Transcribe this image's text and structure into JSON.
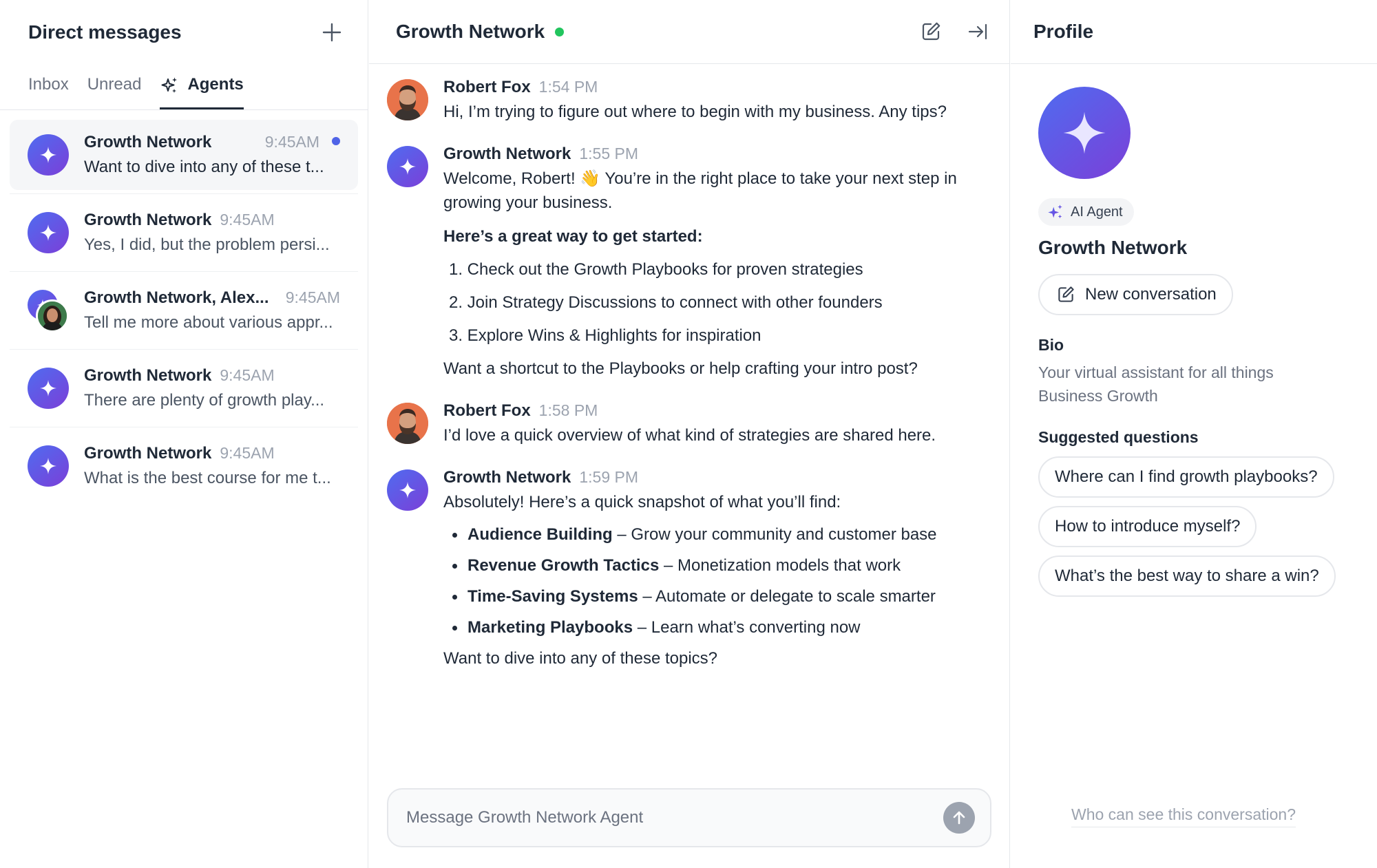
{
  "left": {
    "title": "Direct messages",
    "tabs": [
      {
        "label": "Inbox"
      },
      {
        "label": "Unread"
      },
      {
        "label": "Agents"
      }
    ],
    "conversations": [
      {
        "name": "Growth Network",
        "time": "9:45AM",
        "snippet": "Want to dive into any of these t...",
        "unread": true
      },
      {
        "name": "Growth Network",
        "time": "9:45AM",
        "snippet": "Yes, I did, but the problem persi..."
      },
      {
        "name": "Growth Network, Alex...",
        "time": "9:45AM",
        "snippet": "Tell me more about various appr..."
      },
      {
        "name": "Growth Network",
        "time": "9:45AM",
        "snippet": "There are plenty of growth play..."
      },
      {
        "name": "Growth Network",
        "time": "9:45AM",
        "snippet": "What is the best course for me t..."
      }
    ]
  },
  "chat": {
    "title": "Growth Network",
    "status_color": "#22c55e",
    "messages": [
      {
        "author": "Robert Fox",
        "time": "1:54 PM",
        "text": "Hi, I’m trying to figure out where to begin with my business. Any tips?"
      },
      {
        "author": "Growth Network",
        "time": "1:55 PM",
        "intro": "Welcome, Robert! 👋 You’re in the right place to take your next step in growing your business.",
        "heading": "Here’s a great way to get started:",
        "steps": [
          "1. Check out the Growth Playbooks for proven strategies",
          "2. Join Strategy Discussions to connect with other founders",
          "3. Explore Wins & Highlights for inspiration"
        ],
        "outro": "Want a shortcut to the Playbooks or help crafting your intro post?"
      },
      {
        "author": "Robert Fox",
        "time": "1:58 PM",
        "text": "I’d love a quick overview of what kind of strategies are shared here."
      },
      {
        "author": "Growth Network",
        "time": "1:59 PM",
        "intro": "Absolutely! Here’s a quick snapshot of what you’ll find:",
        "bullets": [
          {
            "title": "Audience Building",
            "desc": " – Grow your community and customer base"
          },
          {
            "title": "Revenue Growth Tactics",
            "desc": " – Monetization models that work"
          },
          {
            "title": "Time-Saving Systems",
            "desc": " – Automate or delegate to scale smarter"
          },
          {
            "title": "Marketing Playbooks",
            "desc": " – Learn what’s converting now"
          }
        ],
        "outro": "Want to dive into any of these topics?"
      }
    ],
    "composer": {
      "placeholder": "Message Growth Network Agent"
    }
  },
  "profile": {
    "title": "Profile",
    "badge": "AI Agent",
    "name": "Growth Network",
    "new_conversation": "New conversation",
    "bio_title": "Bio",
    "bio": "Your virtual assistant for all things Business Growth",
    "suggested_title": "Suggested questions",
    "suggestions": [
      "Where can I find growth playbooks?",
      "How to introduce myself?",
      "What’s the best way to share a win?"
    ],
    "visibility_link": "Who can see this conversation?"
  },
  "colors": {
    "accent": "#4f63e7",
    "agent_gradient_start": "#4f6cf0",
    "agent_gradient_end": "#7b3fd8",
    "online": "#22c55e"
  }
}
